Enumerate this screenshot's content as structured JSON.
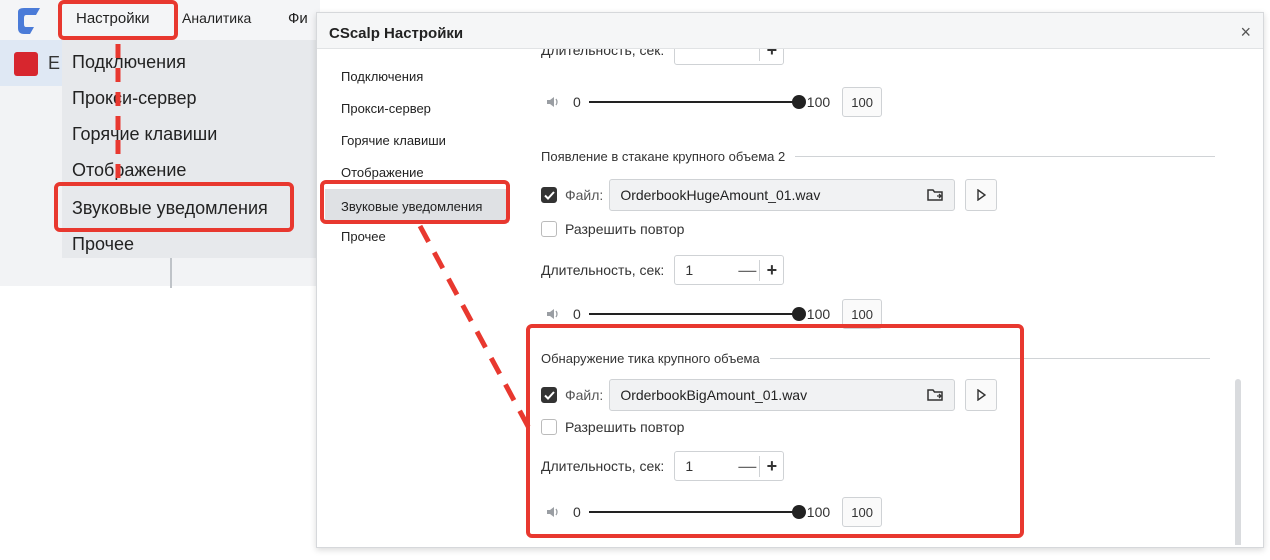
{
  "menubar": {
    "settings": "Настройки",
    "analytics": "Аналитика",
    "cut": "Фи"
  },
  "row_letter": "E",
  "dropdown": [
    "Подключения",
    "Прокси-сервер",
    "Горячие клавиши",
    "Отображение",
    "Звуковые уведомления",
    "Прочее"
  ],
  "dialog": {
    "title": "CScalp Настройки",
    "close": "×",
    "nav": [
      "Подключения",
      "Прокси-сервер",
      "Горячие клавиши",
      "Отображение",
      "Звуковые уведомления",
      "Прочее"
    ],
    "active_nav": "Звуковые уведомления",
    "top_partial": {
      "duration_label": "Длительность, сек:",
      "volume_min": "0",
      "volume_max": "100",
      "volume_value": "100"
    },
    "sections": [
      {
        "title": "Появление в стакане крупного объема 2",
        "file_label": "Файл:",
        "file_checked": true,
        "file_name": "OrderbookHugeAmount_01.wav",
        "repeat_label": "Разрешить повтор",
        "repeat_checked": false,
        "duration_label": "Длительность, сек:",
        "duration_value": "1",
        "minus": "—",
        "plus": "+",
        "volume_min": "0",
        "volume_max": "100",
        "volume_value": "100",
        "volume_level": 1.0
      },
      {
        "title": "Обнаружение тика крупного объема",
        "file_label": "Файл:",
        "file_checked": true,
        "file_name": "OrderbookBigAmount_01.wav",
        "repeat_label": "Разрешить повтор",
        "repeat_checked": false,
        "duration_label": "Длительность, сек:",
        "duration_value": "1",
        "minus": "—",
        "plus": "+",
        "volume_min": "0",
        "volume_max": "100",
        "volume_value": "100",
        "volume_level": 1.0
      }
    ]
  },
  "colors": {
    "annotation": "#e8382f",
    "brand": "#d7262e",
    "logo": "#4a7bd8"
  },
  "icons": [
    "app-logo-icon",
    "checkbox-check-icon",
    "folder-icon",
    "play-icon",
    "volume-icon",
    "close-icon"
  ]
}
